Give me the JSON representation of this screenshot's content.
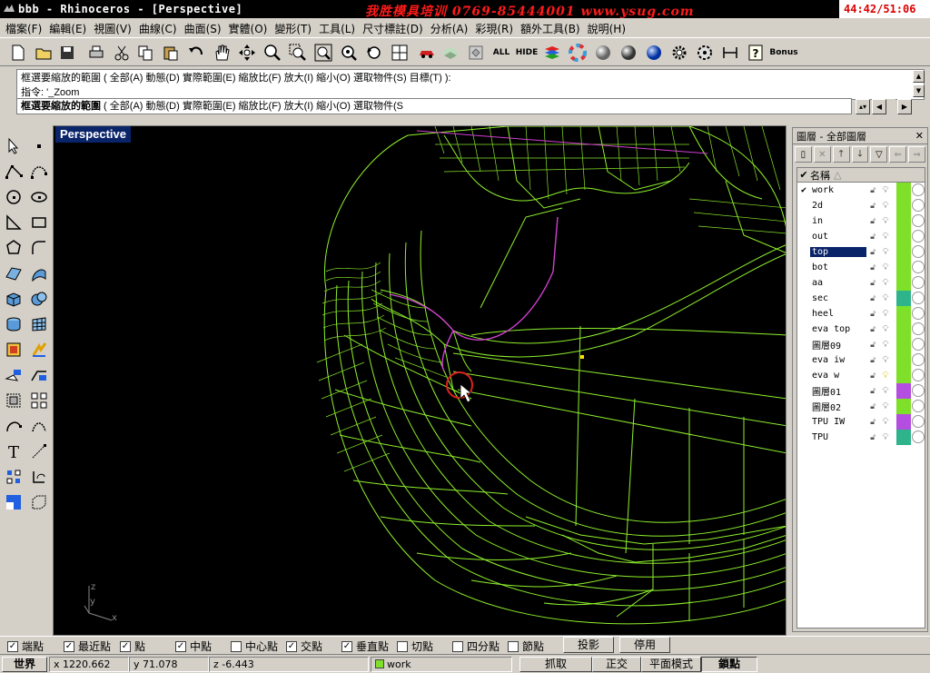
{
  "window": {
    "title": "bbb - Rhinoceros - [Perspective]",
    "ad_text": "我胜模具培训  0769-85444001  www.ysug.com",
    "clock": "44:42/51:06"
  },
  "menu": [
    "檔案(F)",
    "編輯(E)",
    "視圖(V)",
    "曲線(C)",
    "曲面(S)",
    "實體(O)",
    "變形(T)",
    "工具(L)",
    "尺寸標註(D)",
    "分析(A)",
    "彩現(R)",
    "額外工具(B)",
    "說明(H)"
  ],
  "toolbar": {
    "all_label": "ALL",
    "hide_label": "HIDE",
    "bonus_label": "Bonus"
  },
  "command": {
    "history_line1": "框選要縮放的範圍 ( 全部(A)  動態(D)  實際範圍(E)  縮放比(F)  放大(I)  縮小(O)  選取物件(S)  目標(T) ):",
    "history_line2": "指令: '_Zoom",
    "prompt_bold": "框選要縮放的範圍",
    "prompt_rest": " ( 全部(A)  動態(D)  實際範圍(E)  縮放比(F)  放大(I)  縮小(O)  選取物件(S"
  },
  "viewport": {
    "name": "Perspective",
    "axis_x": "x",
    "axis_y": "y",
    "axis_z": "z"
  },
  "layers": {
    "title": "圖層 - 全部圖層",
    "header_name": "名稱",
    "items": [
      {
        "name": "work",
        "current": true,
        "color": "#7fe02a"
      },
      {
        "name": "2d",
        "color": "#7fe02a"
      },
      {
        "name": "in",
        "color": "#7fe02a"
      },
      {
        "name": "out",
        "color": "#7fe02a"
      },
      {
        "name": "top",
        "selected": true,
        "color": "#7fe02a"
      },
      {
        "name": "bot",
        "color": "#7fe02a"
      },
      {
        "name": "aa",
        "color": "#7fe02a"
      },
      {
        "name": "sec",
        "color": "#2fb38a"
      },
      {
        "name": "heel",
        "color": "#7fe02a"
      },
      {
        "name": "eva top",
        "color": "#7fe02a"
      },
      {
        "name": "圖層09",
        "color": "#7fe02a"
      },
      {
        "name": "eva iw",
        "color": "#7fe02a"
      },
      {
        "name": "eva w",
        "color": "#7fe02a",
        "bulb_on": true
      },
      {
        "name": "圖層01",
        "color": "#b44ee0"
      },
      {
        "name": "圖層02",
        "color": "#7fe02a"
      },
      {
        "name": "TPU IW",
        "color": "#b44ee0"
      },
      {
        "name": "TPU",
        "color": "#2fb38a"
      }
    ]
  },
  "osnap": {
    "end": "端點",
    "near": "最近點",
    "point": "點",
    "mid": "中點",
    "center": "中心點",
    "intersection": "交點",
    "perp": "垂直點",
    "tan": "切點",
    "quad": "四分點",
    "knot": "節點",
    "project_btn": "投影",
    "disable_btn": "停用"
  },
  "status": {
    "cplane": "世界",
    "x": "x 1220.662",
    "y": "y 71.078",
    "z": "z -6.443",
    "layer": "work",
    "snap": "抓取",
    "ortho": "正交",
    "planar": "平面模式",
    "osnap": "鎖點"
  },
  "colors": {
    "mesh": "#8ef02c",
    "highlight": "#d040d0",
    "selected": "#0a246a"
  }
}
